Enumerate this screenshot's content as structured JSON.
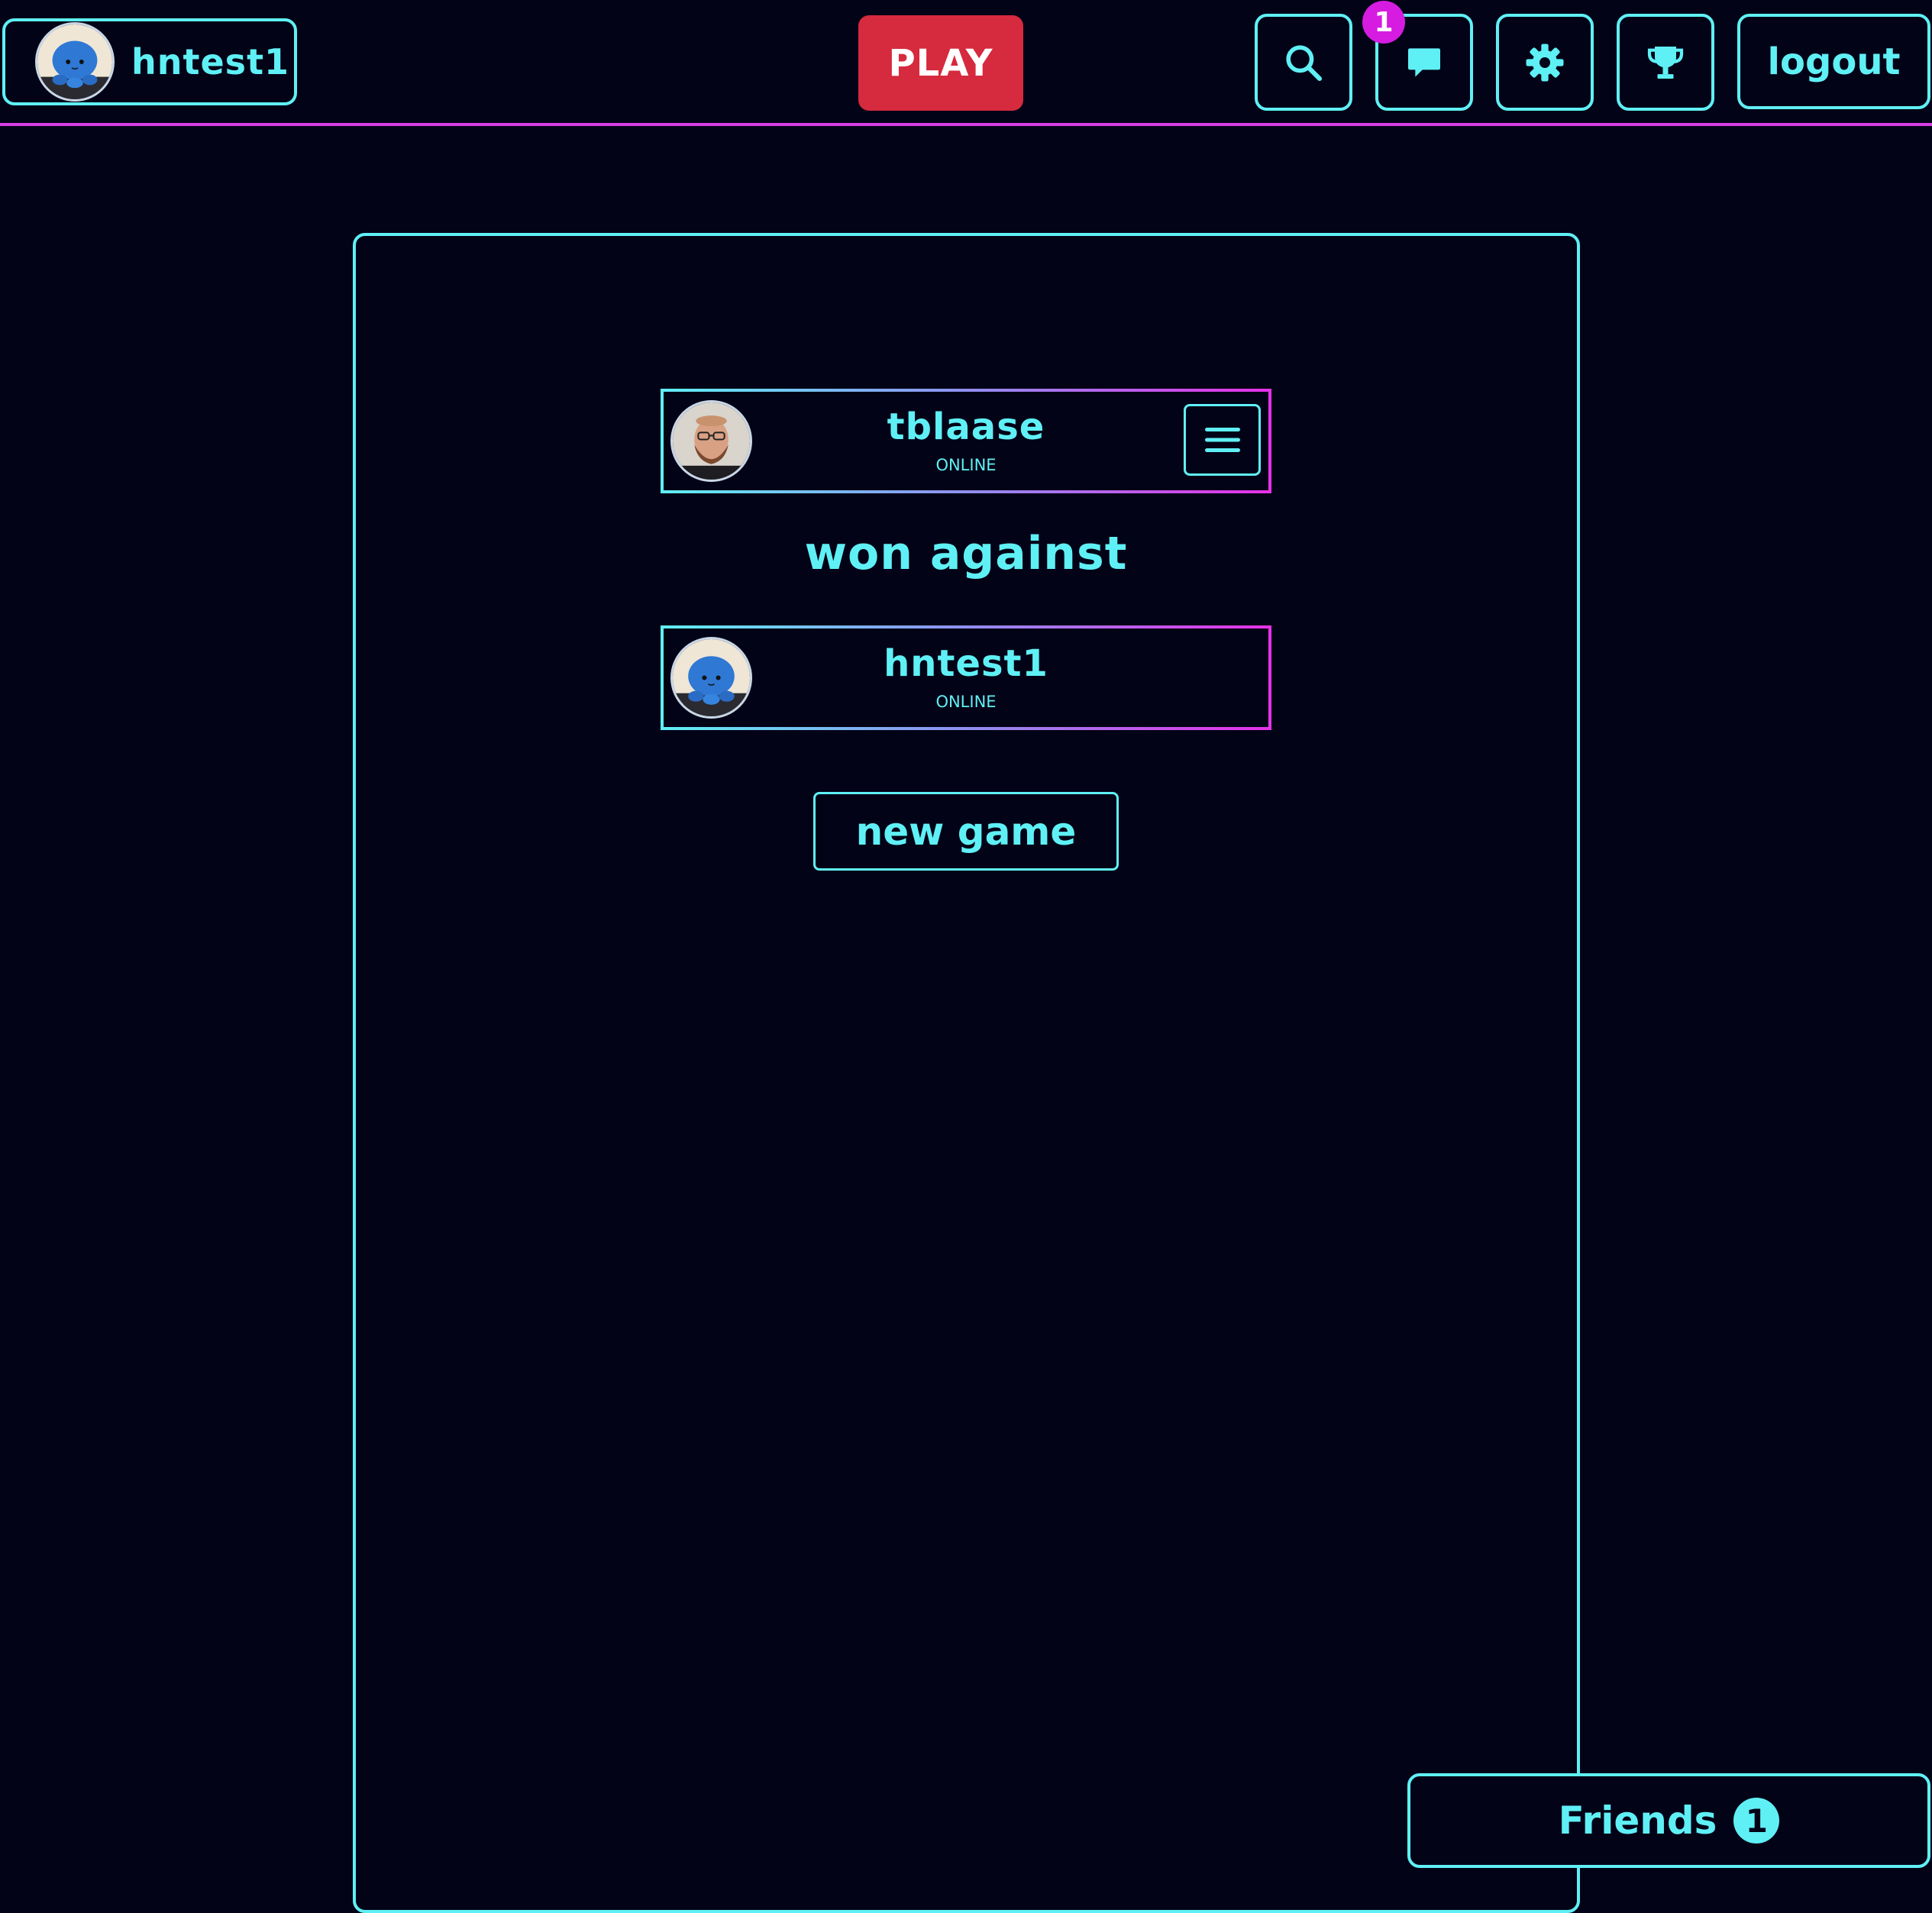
{
  "header": {
    "current_user": {
      "name": "hntest1",
      "avatar": "octopus-avatar"
    },
    "play_label": "PLAY",
    "icons": {
      "search": "search-icon",
      "chat": "chat-icon",
      "settings": "gear-icon",
      "leaderboard": "trophy-icon"
    },
    "chat_notification_count": "1",
    "logout_label": "logout"
  },
  "result": {
    "winner": {
      "name": "tblaase",
      "status": "ONLINE",
      "avatar": "man-photo-avatar"
    },
    "verb": "won against",
    "loser": {
      "name": "hntest1",
      "status": "ONLINE",
      "avatar": "octopus-avatar"
    },
    "new_game_label": "new game"
  },
  "friends": {
    "label": "Friends",
    "count": "1"
  },
  "colors": {
    "background": "#030317",
    "accent": "#5ff0f5",
    "magenta": "#d93fe6",
    "play": "#d62a3e",
    "badge": "#d61ce0"
  }
}
